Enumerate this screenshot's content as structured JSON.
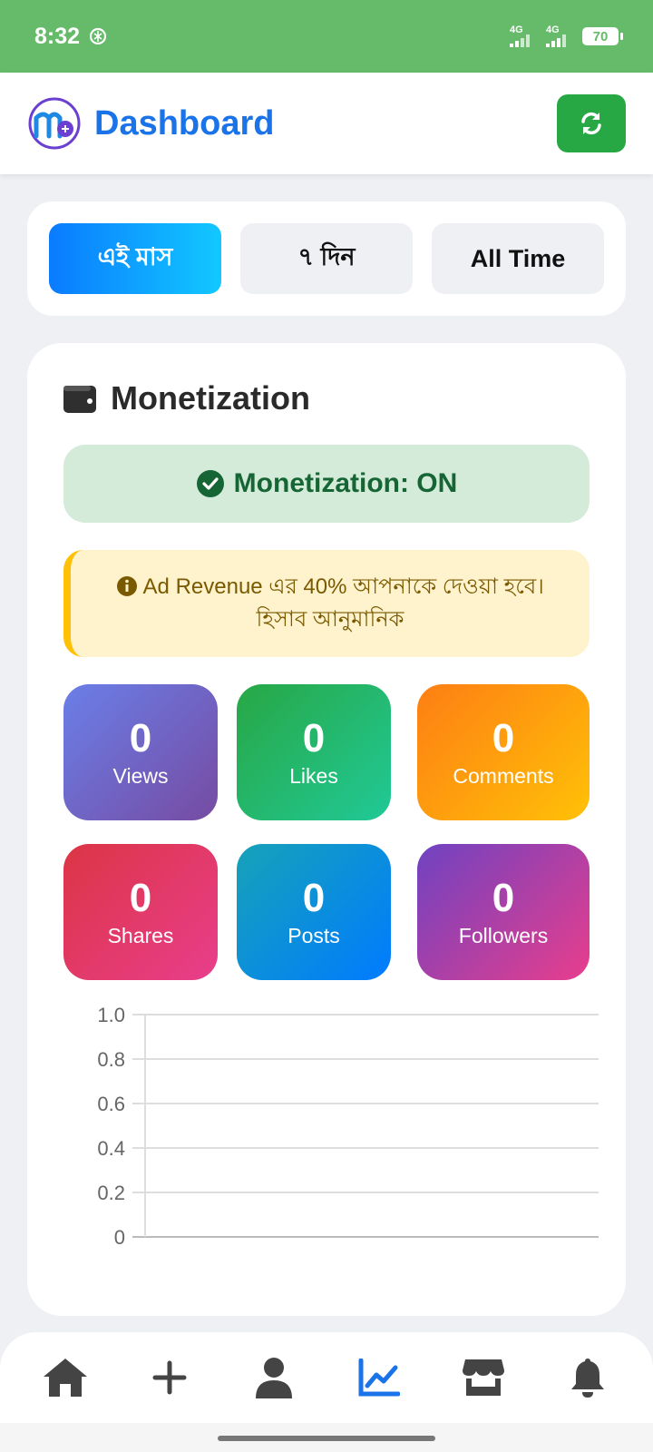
{
  "status_bar": {
    "time": "8:32",
    "net1": "4G",
    "net2": "4G",
    "battery": "70"
  },
  "header": {
    "title": "Dashboard"
  },
  "filters": [
    {
      "label": "এই মাস",
      "active": true
    },
    {
      "label": "৭ দিন",
      "active": false
    },
    {
      "label": "All Time",
      "active": false
    }
  ],
  "monetization": {
    "section_title": "Monetization",
    "status": "Monetization: ON",
    "info_line1": "Ad Revenue এর 40% আপনাকে দেওয়া হবে।",
    "info_line2": "হিসাব আনুমানিক"
  },
  "stats": [
    {
      "value": "0",
      "label": "Views"
    },
    {
      "value": "0",
      "label": "Likes"
    },
    {
      "value": "0",
      "label": "Comments"
    },
    {
      "value": "0",
      "label": "Shares"
    },
    {
      "value": "0",
      "label": "Posts"
    },
    {
      "value": "0",
      "label": "Followers"
    }
  ],
  "chart_data": {
    "type": "line",
    "series": [],
    "y_ticks": [
      "1.0",
      "0.8",
      "0.6",
      "0.4",
      "0.2",
      "0"
    ],
    "ylim": [
      0,
      1
    ],
    "grid": true
  },
  "colors": {
    "status_bar": "#66bb6a",
    "brand_blue": "#1a73e8",
    "refresh_green": "#27a844",
    "nav_active": "#1a73e8"
  },
  "bottom_nav": [
    "home-icon",
    "add-icon",
    "user-icon",
    "chart-line-icon",
    "store-icon",
    "bell-icon"
  ]
}
